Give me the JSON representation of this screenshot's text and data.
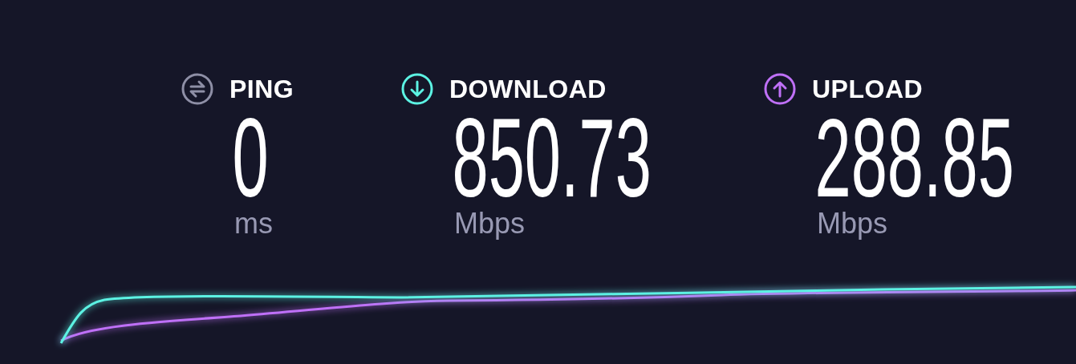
{
  "metrics": [
    {
      "kind": "ping",
      "label": "PING",
      "value": "0",
      "unit": "ms",
      "color": "#8e8fa6"
    },
    {
      "kind": "download",
      "label": "DOWNLOAD",
      "value": "850.73",
      "unit": "Mbps",
      "color": "#5cf2e3"
    },
    {
      "kind": "upload",
      "label": "UPLOAD",
      "value": "288.85",
      "unit": "Mbps",
      "color": "#bf70f7"
    }
  ]
}
